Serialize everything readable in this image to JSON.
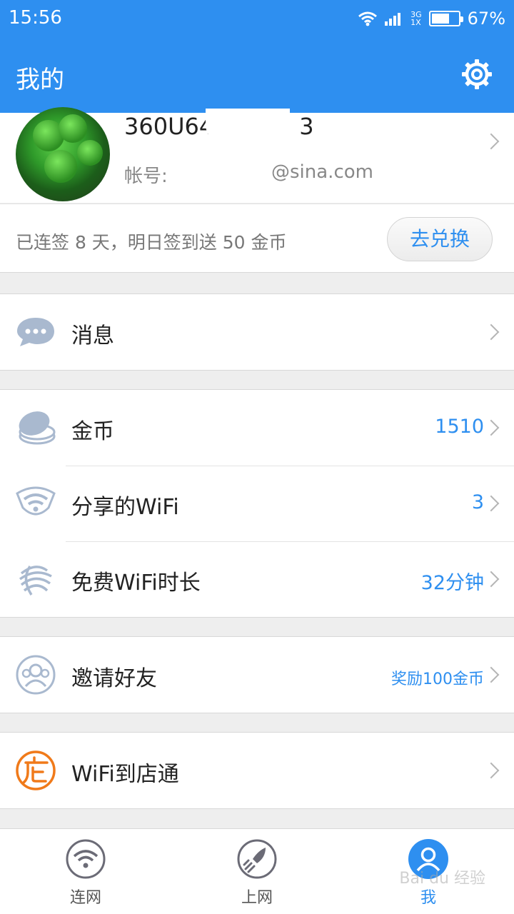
{
  "status": {
    "time": "15:56",
    "network": [
      "3G",
      "1X"
    ],
    "battery": "67%",
    "battery_level": 0.67
  },
  "header": {
    "title": "我的"
  },
  "profile": {
    "username": "360U64",
    "username_suffix": "3",
    "account_label": "帐号:",
    "account_email": "@sina.com"
  },
  "signin": {
    "text": "已连签 8 天，明日签到送 50 金币",
    "button": "去兑换"
  },
  "menu": [
    {
      "label": "消息",
      "value": ""
    },
    {
      "label": "金币",
      "value": "1510"
    },
    {
      "label": "分享的WiFi",
      "value": "3"
    },
    {
      "label": "免费WiFi时长",
      "value": "32分钟"
    },
    {
      "label": "邀请好友",
      "value": "奖励100金币"
    },
    {
      "label": "WiFi到店通",
      "value": ""
    }
  ],
  "tabs": [
    {
      "label": "连网"
    },
    {
      "label": "上网"
    },
    {
      "label": "我"
    }
  ],
  "watermark": "Bai du 经验",
  "colors": {
    "primary": "#2e8ff0",
    "icon_gray": "#a9b9cf",
    "orange": "#f07a1a"
  }
}
